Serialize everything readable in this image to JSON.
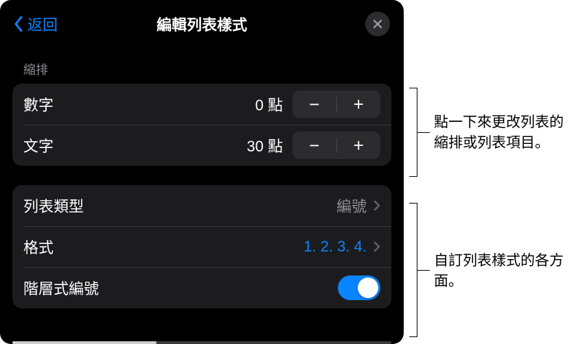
{
  "header": {
    "back_label": "返回",
    "title": "編輯列表樣式"
  },
  "indent": {
    "section_label": "縮排",
    "number": {
      "label": "數字",
      "value": "0 點"
    },
    "text": {
      "label": "文字",
      "value": "30 點"
    }
  },
  "list": {
    "type": {
      "label": "列表類型",
      "value": "編號"
    },
    "format": {
      "label": "格式",
      "value": "1. 2. 3. 4."
    },
    "hierarchical": {
      "label": "階層式編號",
      "on": true
    }
  },
  "callouts": {
    "c1": "點一下來更改列表的縮排或列表項目。",
    "c2": "自訂列表樣式的各方面。"
  }
}
